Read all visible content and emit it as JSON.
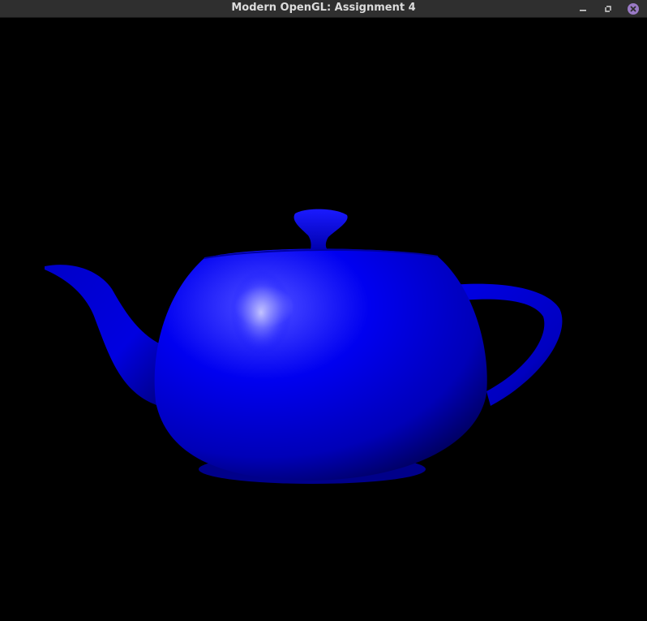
{
  "window": {
    "title": "Modern OpenGL: Assignment 4",
    "controls": {
      "minimize_icon": "minimize-icon",
      "maximize_icon": "maximize-icon",
      "close_icon": "close-icon"
    }
  },
  "scene": {
    "background_color": "#000000",
    "object": "teapot",
    "object_color": "#0000ff",
    "highlight_color": "#9f9fff"
  }
}
